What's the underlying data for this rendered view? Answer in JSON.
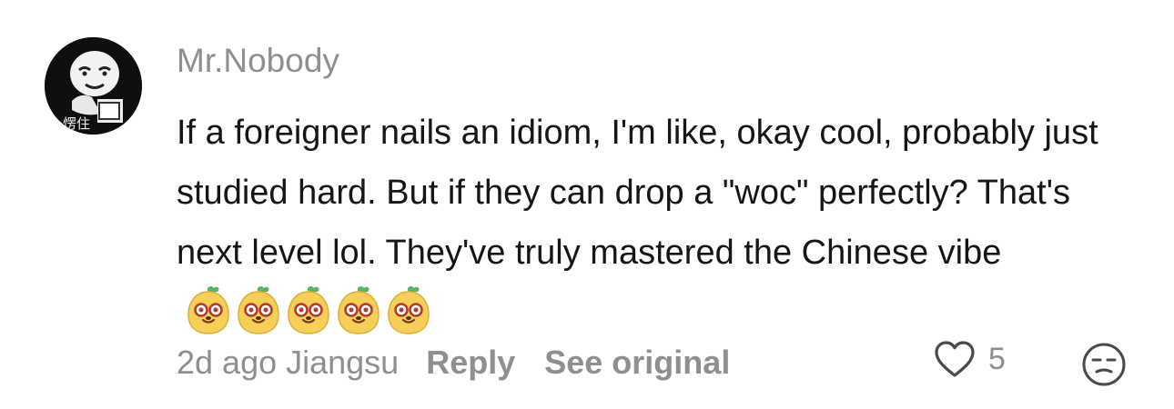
{
  "comment": {
    "username": "Mr.Nobody",
    "avatar_caption": "愣住",
    "text": "If a foreigner nails an idiom, I'm like, okay cool, probably just studied hard. But if they can drop a \"woc\" perfectly? That's next level lol. They've truly mastered the Chinese vibe",
    "emoji_icons": [
      "mango-face-icon",
      "mango-face-icon",
      "mango-face-icon",
      "mango-face-icon",
      "mango-face-icon"
    ],
    "meta": {
      "time_location": "2d ago Jiangsu",
      "reply_label": "Reply",
      "see_original_label": "See original"
    },
    "like_count": "5",
    "icons": {
      "like": "heart-icon",
      "reaction": "expressionless-face-icon"
    },
    "colors": {
      "text": "#161616",
      "muted": "#8e8e93",
      "emoji_fill": "#f5cf58"
    }
  }
}
